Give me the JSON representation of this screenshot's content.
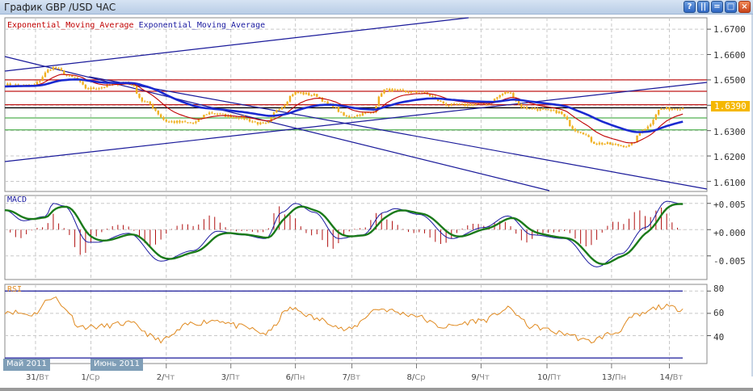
{
  "window": {
    "title": "График GBP /USD  ЧАС",
    "buttons": [
      "?",
      "||",
      "=",
      "□",
      "×"
    ]
  },
  "legend": {
    "ema1": "Exponential_Moving_Average",
    "ema2": "Exponential_Moving_Average"
  },
  "colors": {
    "price": "#f0b020",
    "ema_fast": "#c00000",
    "ema_slow": "#1a2ad0",
    "macd": "#1a1aa0",
    "signal": "#1a7a1a",
    "hist": "#b01010",
    "rsi": "#e08a20",
    "trend": "#1a1a9a",
    "grid": "#c8c8c8"
  },
  "main_axis": {
    "labels": [
      "1.6700",
      "1.6600",
      "1.6500",
      "1.6300",
      "1.6200",
      "1.6100"
    ],
    "values": [
      1.67,
      1.66,
      1.65,
      1.63,
      1.62,
      1.61
    ],
    "current": "1.6390",
    "current_value": 1.639
  },
  "levels": {
    "red": [
      1.65,
      1.6455,
      1.6402
    ],
    "black": [
      1.639
    ],
    "green": [
      1.635,
      1.6303
    ]
  },
  "macd_panel": {
    "title": "MACD",
    "labels": [
      "+0.005",
      "+0.000",
      "-0.005"
    ],
    "values": [
      0.005,
      0,
      -0.005
    ]
  },
  "rsi_panel": {
    "title": "RSI",
    "labels": [
      "80",
      "60",
      "40"
    ],
    "values": [
      80,
      60,
      40
    ],
    "bands": [
      80,
      20
    ]
  },
  "dates": [
    {
      "day": "31",
      "wd": "Вт",
      "h": 11.4
    },
    {
      "day": "1",
      "wd": "Ср",
      "h": 32
    },
    {
      "day": "2",
      "wd": "Чт",
      "h": 60
    },
    {
      "day": "3",
      "wd": "Пт",
      "h": 84
    },
    {
      "day": "6",
      "wd": "Пн",
      "h": 108
    },
    {
      "day": "7",
      "wd": "Вт",
      "h": 129
    },
    {
      "day": "8",
      "wd": "Ср",
      "h": 153
    },
    {
      "day": "9",
      "wd": "Чт",
      "h": 177
    },
    {
      "day": "10",
      "wd": "Пт",
      "h": 201.5
    },
    {
      "day": "13",
      "wd": "Пн",
      "h": 225.5
    },
    {
      "day": "14",
      "wd": "Вт",
      "h": 247
    }
  ],
  "months": [
    "Май 2011",
    "Июнь 2011"
  ],
  "chart_data": {
    "type": "line",
    "title": "GBP/USD hourly",
    "x_unit": "hour index",
    "price_knots": [
      [
        0,
        1.648
      ],
      [
        10,
        1.6478
      ],
      [
        18,
        1.6548
      ],
      [
        25,
        1.651
      ],
      [
        31,
        1.6465
      ],
      [
        46,
        1.649
      ],
      [
        52,
        1.6412
      ],
      [
        61,
        1.6335
      ],
      [
        70,
        1.633
      ],
      [
        76,
        1.637
      ],
      [
        85,
        1.6355
      ],
      [
        97,
        1.6325
      ],
      [
        102,
        1.639
      ],
      [
        108,
        1.645
      ],
      [
        115,
        1.644
      ],
      [
        121,
        1.64
      ],
      [
        127,
        1.6355
      ],
      [
        136,
        1.637
      ],
      [
        141,
        1.646
      ],
      [
        154,
        1.645
      ],
      [
        166,
        1.64
      ],
      [
        178,
        1.6405
      ],
      [
        187,
        1.645
      ],
      [
        193,
        1.639
      ],
      [
        205,
        1.6375
      ],
      [
        213,
        1.63
      ],
      [
        220,
        1.625
      ],
      [
        232,
        1.624
      ],
      [
        238,
        1.631
      ],
      [
        244,
        1.6385
      ],
      [
        252,
        1.639
      ]
    ],
    "macd_knots": [
      [
        0,
        0.0037
      ],
      [
        7,
        0.0017
      ],
      [
        15,
        0.0025
      ],
      [
        18,
        0.005
      ],
      [
        22,
        0.0045
      ],
      [
        31,
        -0.0024
      ],
      [
        34,
        -0.0024
      ],
      [
        46,
        -0.0007
      ],
      [
        58,
        -0.006
      ],
      [
        70,
        -0.004
      ],
      [
        79,
        -0.0003
      ],
      [
        88,
        -0.001
      ],
      [
        97,
        -0.0017
      ],
      [
        103,
        0.0033
      ],
      [
        108,
        0.005
      ],
      [
        115,
        0.0033
      ],
      [
        124,
        -0.0017
      ],
      [
        133,
        -0.001
      ],
      [
        141,
        0.0033
      ],
      [
        145,
        0.004
      ],
      [
        154,
        0.0029
      ],
      [
        166,
        -0.0017
      ],
      [
        178,
        0.0004
      ],
      [
        187,
        0.0026
      ],
      [
        196,
        -0.001
      ],
      [
        208,
        -0.0017
      ],
      [
        220,
        -0.0071
      ],
      [
        229,
        -0.0046
      ],
      [
        238,
        0.0004
      ],
      [
        246,
        0.0054
      ],
      [
        252,
        0.0049
      ]
    ],
    "rsi_knots": [
      [
        0,
        62
      ],
      [
        10,
        59
      ],
      [
        18,
        75
      ],
      [
        22,
        65
      ],
      [
        28,
        48
      ],
      [
        34,
        48
      ],
      [
        46,
        51
      ],
      [
        58,
        36
      ],
      [
        70,
        51
      ],
      [
        79,
        54
      ],
      [
        88,
        48
      ],
      [
        97,
        42
      ],
      [
        106,
        64
      ],
      [
        118,
        54
      ],
      [
        127,
        45
      ],
      [
        139,
        64
      ],
      [
        151,
        59
      ],
      [
        163,
        48
      ],
      [
        178,
        54
      ],
      [
        187,
        64
      ],
      [
        196,
        48
      ],
      [
        208,
        42
      ],
      [
        217,
        35
      ],
      [
        226,
        42
      ],
      [
        235,
        58
      ],
      [
        244,
        66
      ],
      [
        252,
        64
      ]
    ],
    "ylim_price": [
      1.606,
      1.6745
    ],
    "ylim_macd": [
      -0.0095,
      0.0065
    ],
    "ylim_rsi": [
      15,
      86
    ]
  }
}
